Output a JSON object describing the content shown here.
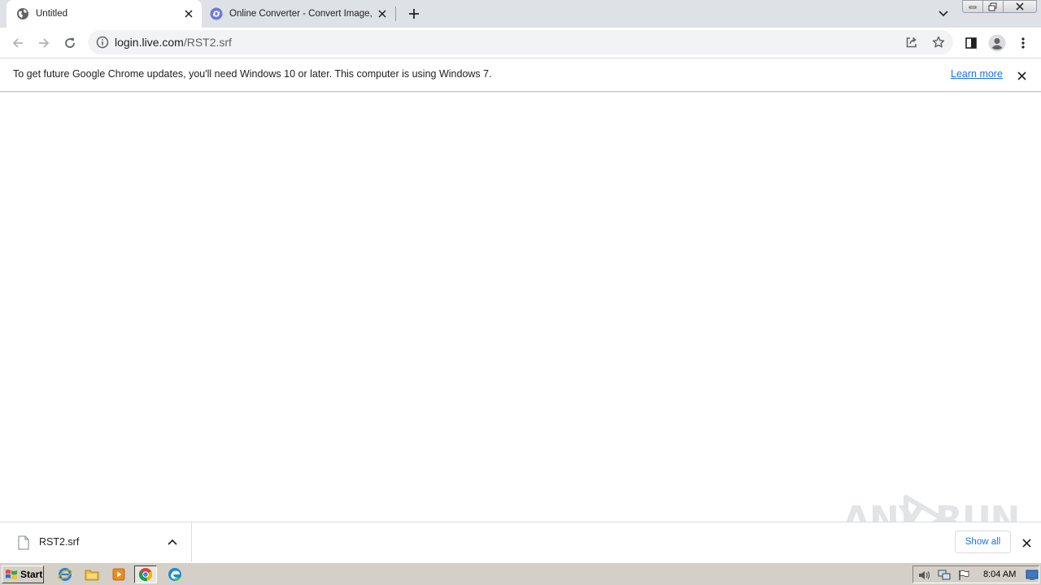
{
  "tabs": [
    {
      "title": "Untitled",
      "icon": "globe-icon"
    },
    {
      "title": "Online Converter - Convert Image, Video, Document",
      "icon": "converter-icon"
    }
  ],
  "window": {
    "min_icon": "minimize-icon",
    "max_icon": "restore-icon",
    "close_icon": "close-icon"
  },
  "toolbar": {
    "url_host": "login.live.com",
    "url_path": "/RST2.srf",
    "icons": [
      "back-arrow-icon",
      "forward-arrow-icon",
      "reload-icon",
      "info-icon",
      "share-icon",
      "star-icon",
      "side-panel-icon",
      "profile-icon",
      "kebab-menu-icon"
    ]
  },
  "infobar": {
    "message": "To get future Google Chrome updates, you'll need Windows 10 or later. This computer is using Windows 7.",
    "link": "Learn more"
  },
  "download_shelf": {
    "file_name": "RST2.srf",
    "show_all": "Show all"
  },
  "watermark": "ANY RUN",
  "taskbar": {
    "start_label": "Start",
    "apps": [
      "internet-explorer-icon",
      "folder-icon",
      "media-player-icon",
      "chrome-icon",
      "edge-icon"
    ],
    "clock": "8:04 AM"
  },
  "colors": {
    "accent": "#1a73e8",
    "tabstrip": "#dee1e6",
    "taskbar": "#d4d0c8"
  }
}
